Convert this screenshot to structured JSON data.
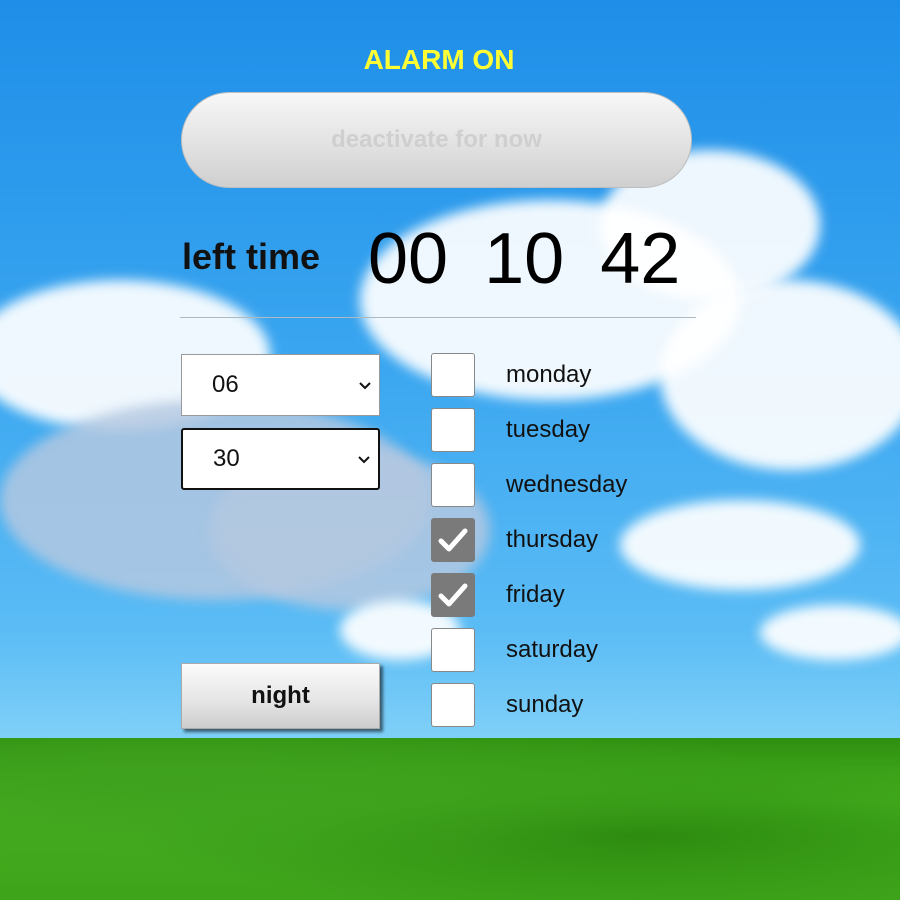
{
  "status": {
    "text": "ALARM ON",
    "color": "#ffff33"
  },
  "deactivate_button": {
    "label": "deactivate for now"
  },
  "countdown": {
    "label": "left time",
    "hours": "00",
    "minutes": "10",
    "seconds": "42"
  },
  "hour_select": {
    "value": "06"
  },
  "minute_select": {
    "value": "30"
  },
  "mode_button": {
    "label": "night"
  },
  "days": [
    {
      "label": "monday",
      "checked": false
    },
    {
      "label": "tuesday",
      "checked": false
    },
    {
      "label": "wednesday",
      "checked": false
    },
    {
      "label": "thursday",
      "checked": true
    },
    {
      "label": "friday",
      "checked": true
    },
    {
      "label": "saturday",
      "checked": false
    },
    {
      "label": "sunday",
      "checked": false
    }
  ],
  "icons": {
    "select_arrow": "chevron-down-icon",
    "check": "checkmark-icon"
  }
}
